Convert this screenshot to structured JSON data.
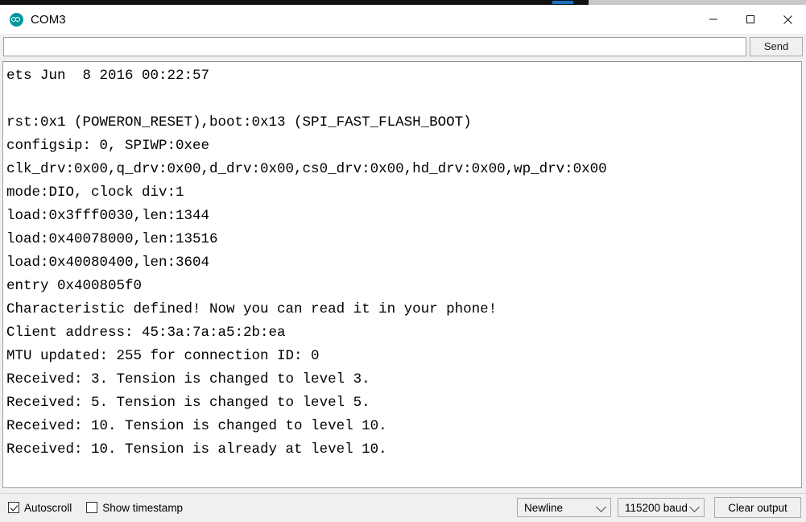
{
  "window": {
    "title": "COM3",
    "logo_icon": "arduino-infinity-icon",
    "controls": {
      "minimize": "minimize-icon",
      "maximize": "maximize-icon",
      "close": "close-icon"
    }
  },
  "send_row": {
    "input_value": "",
    "input_placeholder": "",
    "send_label": "Send"
  },
  "console": {
    "lines": [
      "ets Jun  8 2016 00:22:57",
      "",
      "rst:0x1 (POWERON_RESET),boot:0x13 (SPI_FAST_FLASH_BOOT)",
      "configsip: 0, SPIWP:0xee",
      "clk_drv:0x00,q_drv:0x00,d_drv:0x00,cs0_drv:0x00,hd_drv:0x00,wp_drv:0x00",
      "mode:DIO, clock div:1",
      "load:0x3fff0030,len:1344",
      "load:0x40078000,len:13516",
      "load:0x40080400,len:3604",
      "entry 0x400805f0",
      "Characteristic defined! Now you can read it in your phone!",
      "Client address: 45:3a:7a:a5:2b:ea",
      "MTU updated: 255 for connection ID: 0",
      "Received: 3. Tension is changed to level 3.",
      "Received: 5. Tension is changed to level 5.",
      "Received: 10. Tension is changed to level 10.",
      "Received: 10. Tension is already at level 10."
    ]
  },
  "status_bar": {
    "autoscroll": {
      "label": "Autoscroll",
      "checked": true
    },
    "show_timestamp": {
      "label": "Show timestamp",
      "checked": false
    },
    "line_ending": {
      "selected": "Newline"
    },
    "baud_rate": {
      "selected": "115200 baud"
    },
    "clear_output_label": "Clear output"
  }
}
